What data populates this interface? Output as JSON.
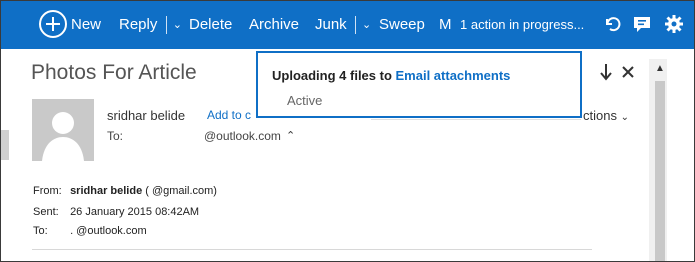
{
  "toolbar": {
    "new_label": "New",
    "reply_label": "Reply",
    "delete_label": "Delete",
    "archive_label": "Archive",
    "junk_label": "Junk",
    "sweep_label": "Sweep",
    "m_label": "M",
    "progress_text": "1 action in progress...",
    "icons": [
      "plus-circle-icon",
      "chevron-down-icon",
      "undo-icon",
      "chat-icon",
      "gear-icon"
    ],
    "accent_color": "#0f6fc6"
  },
  "email": {
    "subject": "Photos For Article",
    "sender_name": "sridhar belide",
    "add_contact": "Add to c",
    "to_label": "To:",
    "to_value": "@outlook.com",
    "expand_glyph": "⌃",
    "actions_label": "ctions",
    "from_label": "From:",
    "from_name": "sridhar belide",
    "from_email": "(                                   @gmail.com)",
    "sent_label": "Sent:",
    "sent_value": "26 January 2015 08:42AM",
    "to2_label": "To:",
    "to2_value": ".                          @outlook.com"
  },
  "toast": {
    "title_prefix": "Uploading 4 files to ",
    "title_link": "Email attachments",
    "status": "Active"
  }
}
